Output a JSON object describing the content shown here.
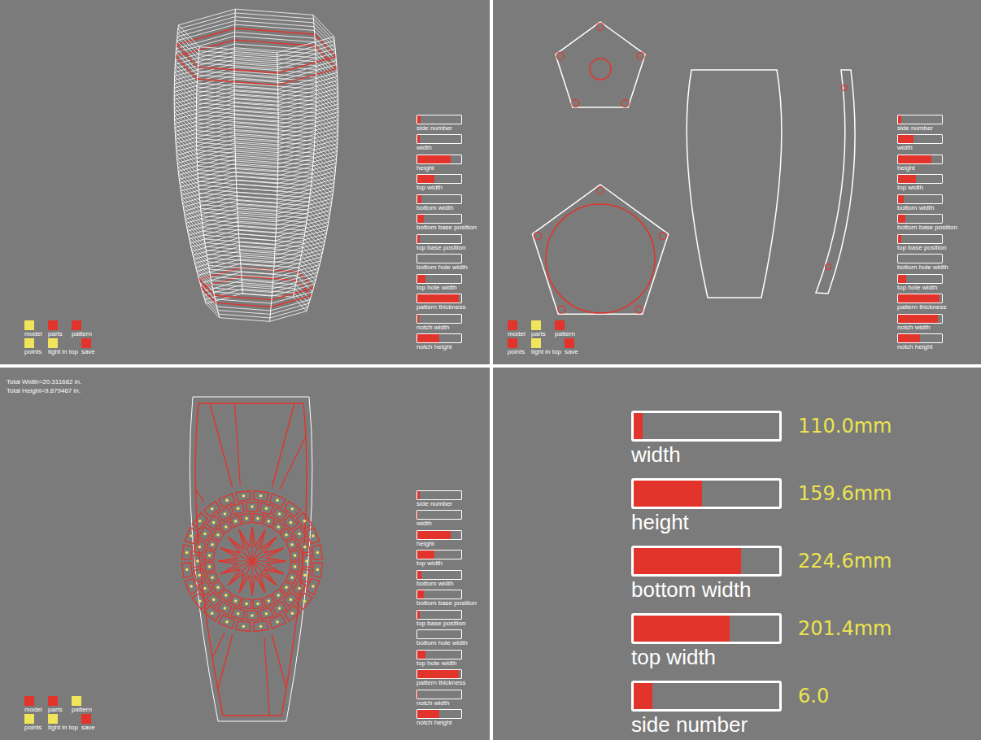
{
  "panels": [
    {
      "kind": "model",
      "info": [],
      "sliders": [
        {
          "label": "side number",
          "level": 0.08
        },
        {
          "label": "width",
          "level": 0.05
        },
        {
          "label": "height",
          "level": 0.75
        },
        {
          "label": "top width",
          "level": 0.38
        },
        {
          "label": "bottom width",
          "level": 0.1
        },
        {
          "label": "bottom base position",
          "level": 0.15
        },
        {
          "label": "top base position",
          "level": 0.05
        },
        {
          "label": "bottom hole width",
          "level": 0
        },
        {
          "label": "top hole width",
          "level": 0.18
        },
        {
          "label": "pattern thickness",
          "level": 0.95
        },
        {
          "label": "notch width",
          "level": 0.03
        },
        {
          "label": "notch height",
          "level": 0.5
        }
      ],
      "toggles": [
        [
          {
            "label": "model",
            "checked": true
          },
          {
            "label": "parts",
            "checked": false
          },
          {
            "label": "pattern",
            "checked": false
          }
        ],
        [
          {
            "label": "points",
            "checked": true
          },
          {
            "label": "tight in top",
            "checked": true
          },
          {
            "label": "save",
            "checked": false
          }
        ]
      ]
    },
    {
      "kind": "parts",
      "info": [],
      "sliders": [
        {
          "label": "side number",
          "level": 0.07
        },
        {
          "label": "width",
          "level": 0.35
        },
        {
          "label": "height",
          "level": 0.75
        },
        {
          "label": "top width",
          "level": 0.4
        },
        {
          "label": "bottom width",
          "level": 0.13
        },
        {
          "label": "bottom base position",
          "level": 0.17
        },
        {
          "label": "top base position",
          "level": 0.08
        },
        {
          "label": "bottom hole width",
          "level": 0
        },
        {
          "label": "top hole width",
          "level": 0.18
        },
        {
          "label": "pattern thickness",
          "level": 0.95
        },
        {
          "label": "notch width",
          "level": 0.9
        },
        {
          "label": "notch height",
          "level": 0.5
        }
      ],
      "toggles": [
        [
          {
            "label": "model",
            "checked": false
          },
          {
            "label": "parts",
            "checked": true
          },
          {
            "label": "pattern",
            "checked": false
          }
        ],
        [
          {
            "label": "points",
            "checked": false
          },
          {
            "label": "tight in top",
            "checked": true
          },
          {
            "label": "save",
            "checked": false
          }
        ]
      ]
    },
    {
      "kind": "pattern",
      "info": [
        "Total Width=20.311682 in.",
        "Total Height=9.879467 in."
      ],
      "sliders": [
        {
          "label": "side number",
          "level": 0.05
        },
        {
          "label": "width",
          "level": 0.02
        },
        {
          "label": "height",
          "level": 0.75
        },
        {
          "label": "top width",
          "level": 0.38
        },
        {
          "label": "bottom width",
          "level": 0.1
        },
        {
          "label": "bottom base position",
          "level": 0.15
        },
        {
          "label": "top base position",
          "level": 0.05
        },
        {
          "label": "bottom hole width",
          "level": 0
        },
        {
          "label": "top hole width",
          "level": 0.18
        },
        {
          "label": "pattern thickness",
          "level": 0.95
        },
        {
          "label": "notch width",
          "level": 0.02
        },
        {
          "label": "notch height",
          "level": 0.5
        }
      ],
      "toggles": [
        [
          {
            "label": "model",
            "checked": false
          },
          {
            "label": "parts",
            "checked": false
          },
          {
            "label": "pattern",
            "checked": true
          }
        ],
        [
          {
            "label": "points",
            "checked": true
          },
          {
            "label": "tight in top",
            "checked": true
          },
          {
            "label": "save",
            "checked": false
          }
        ]
      ]
    }
  ],
  "readouts": [
    {
      "label": "width",
      "reading": "110.0mm",
      "level": 0.06
    },
    {
      "label": "height",
      "reading": "159.6mm",
      "level": 0.47
    },
    {
      "label": "bottom width",
      "reading": "224.6mm",
      "level": 0.74
    },
    {
      "label": "top width",
      "reading": "201.4mm",
      "level": 0.66
    },
    {
      "label": "side number",
      "reading": "6.0",
      "level": 0.13
    }
  ]
}
